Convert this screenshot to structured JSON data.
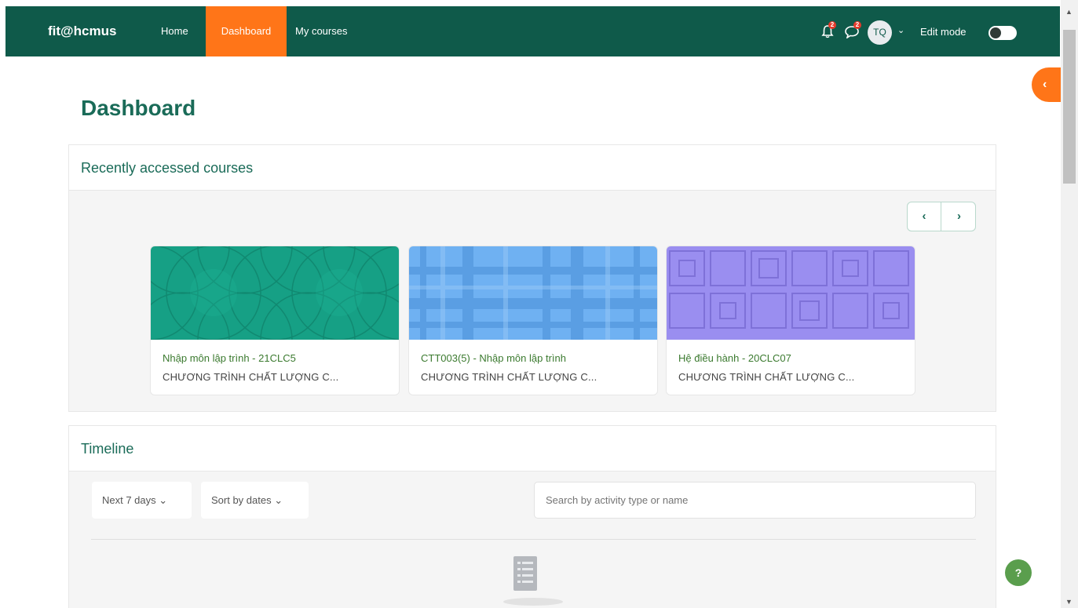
{
  "navbar": {
    "brand": "fit@hcmus",
    "links": [
      "Home",
      "Dashboard",
      "My courses"
    ],
    "notifications_count": "2",
    "messages_count": "2",
    "user_initials": "TQ",
    "edit_mode_label": "Edit mode",
    "edit_mode_on": false,
    "bg_color": "#0f5a4a",
    "active_color": "#ff7518"
  },
  "page_title": "Dashboard",
  "recent": {
    "title": "Recently accessed courses",
    "prev_icon": "chevron-left-icon",
    "next_icon": "chevron-right-icon",
    "courses": [
      {
        "name": "Nhập môn lập trình - 21CLC5",
        "category": "CHƯƠNG TRÌNH CHẤT LƯỢNG C...",
        "pattern": "circles",
        "color": "#16a085"
      },
      {
        "name": "CTT003(5) - Nhập môn lập trình",
        "category": "CHƯƠNG TRÌNH CHẤT LƯỢNG C...",
        "pattern": "plaid",
        "color": "#6fb1f2"
      },
      {
        "name": "Hệ điều hành - 20CLC07",
        "category": "CHƯƠNG TRÌNH CHẤT LƯỢNG C...",
        "pattern": "squares",
        "color": "#9a8ef0"
      }
    ]
  },
  "timeline": {
    "title": "Timeline",
    "range_filter": "Next 7 days",
    "sort_filter": "Sort by dates",
    "search_placeholder": "Search by activity type or name"
  },
  "help_label": "?"
}
